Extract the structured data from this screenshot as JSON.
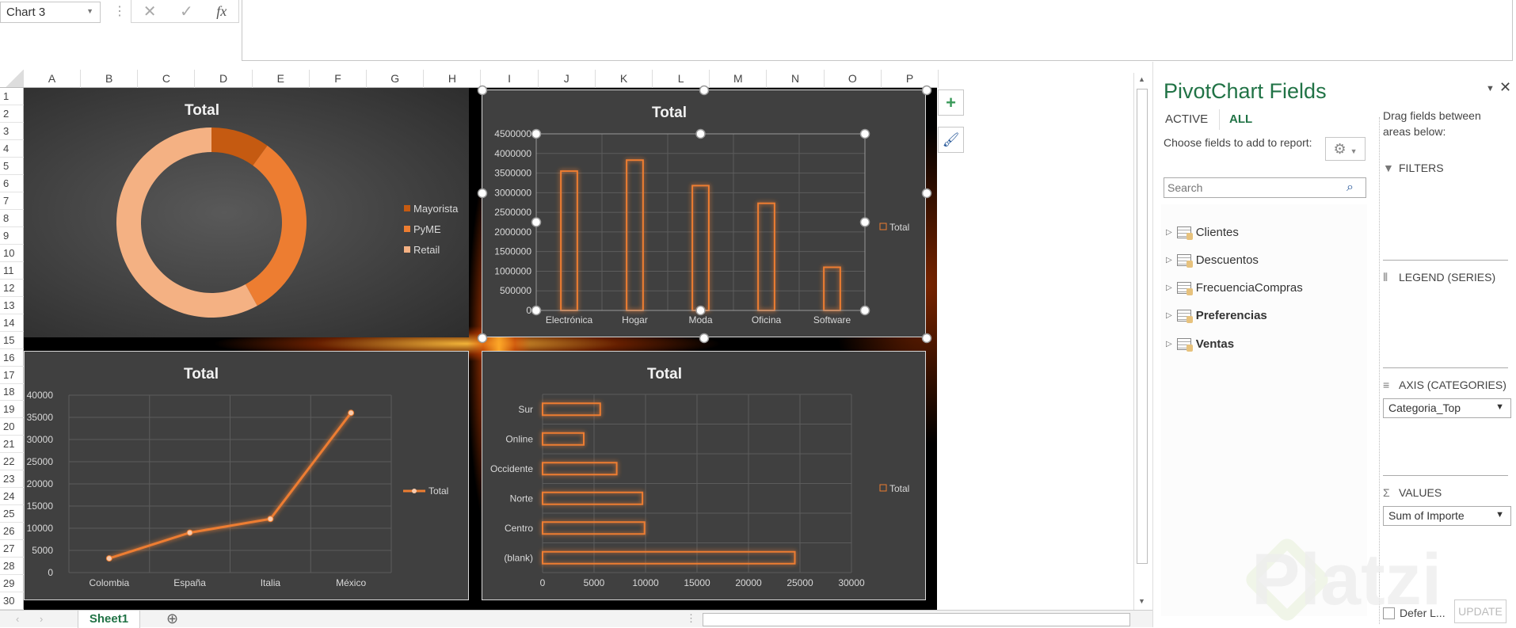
{
  "formula_bar": {
    "name_box": "Chart 3",
    "cancel_icon": "✕",
    "enter_icon": "✓",
    "fx_label": "fx",
    "formula": ""
  },
  "columns": [
    "A",
    "B",
    "C",
    "D",
    "E",
    "F",
    "G",
    "H",
    "I",
    "J",
    "K",
    "L",
    "M",
    "N",
    "O",
    "P"
  ],
  "rows": [
    "1",
    "2",
    "3",
    "4",
    "5",
    "6",
    "7",
    "8",
    "9",
    "10",
    "11",
    "12",
    "13",
    "14",
    "15",
    "16",
    "17",
    "18",
    "19",
    "20",
    "21",
    "22",
    "23",
    "24",
    "25",
    "26",
    "27",
    "28",
    "29",
    "30"
  ],
  "chart_tools": {
    "add_element_icon": "plus-icon",
    "style_icon": "brush-icon"
  },
  "sheet_tabs": {
    "tabs": [
      {
        "label": "Sheet1",
        "active": true
      }
    ],
    "add_icon": "plus-circle-icon"
  },
  "pivot_pane": {
    "title": "PivotChart Fields",
    "tabs": [
      {
        "label": "ACTIVE"
      },
      {
        "label": "ALL"
      }
    ],
    "active_tab": "ALL",
    "choose_label": "Choose fields to add to report:",
    "search_placeholder": "Search",
    "fields": [
      {
        "name": "Clientes",
        "bold": false
      },
      {
        "name": "Descuentos",
        "bold": false
      },
      {
        "name": "FrecuenciaCompras",
        "bold": false
      },
      {
        "name": "Preferencias",
        "bold": true
      },
      {
        "name": "Ventas",
        "bold": true
      }
    ],
    "drag_label": "Drag fields between areas below:",
    "areas": {
      "filters": "FILTERS",
      "legend": "LEGEND (SERIES)",
      "axis": "AXIS (CATEGORIES)",
      "axis_value": "Categoria_Top",
      "values": "VALUES",
      "values_value": "Sum of Importe"
    },
    "defer_label": "Defer L...",
    "update_label": "UPDATE",
    "accent": "#217346"
  },
  "watermark": "Platzi",
  "chart_data": [
    {
      "type": "pie",
      "variant": "donut",
      "title": "Total",
      "categories": [
        "Mayorista",
        "PyME",
        "Retail"
      ],
      "values": [
        10,
        32,
        58
      ],
      "colors": [
        "#C55A11",
        "#ED7D31",
        "#F4B183"
      ],
      "legend": "right"
    },
    {
      "type": "bar",
      "title": "Total",
      "categories": [
        "Electrónica",
        "Hogar",
        "Moda",
        "Oficina",
        "Software"
      ],
      "series": [
        {
          "name": "Total",
          "values": [
            3550000,
            3830000,
            3180000,
            2730000,
            1100000
          ]
        }
      ],
      "ylim": [
        0,
        4500000
      ],
      "ytick": 500000,
      "grid": true,
      "legend": "right",
      "color": "#ED7D31",
      "selected": true
    },
    {
      "type": "line",
      "title": "Total",
      "categories": [
        "Colombia",
        "España",
        "Italia",
        "México"
      ],
      "series": [
        {
          "name": "Total",
          "values": [
            3200,
            9000,
            12100,
            36000
          ]
        }
      ],
      "ylim": [
        0,
        40000
      ],
      "ytick": 5000,
      "grid": true,
      "legend": "right",
      "color": "#ED7D31"
    },
    {
      "type": "bar",
      "orientation": "horizontal",
      "title": "Total",
      "categories": [
        "Sur",
        "Online",
        "Occidente",
        "Norte",
        "Centro",
        "(blank)"
      ],
      "series": [
        {
          "name": "Total",
          "values": [
            5600,
            4000,
            7200,
            9700,
            9900,
            24500
          ]
        }
      ],
      "xlim": [
        0,
        30000
      ],
      "xtick": 5000,
      "grid": true,
      "legend": "right",
      "color": "#ED7D31"
    }
  ]
}
